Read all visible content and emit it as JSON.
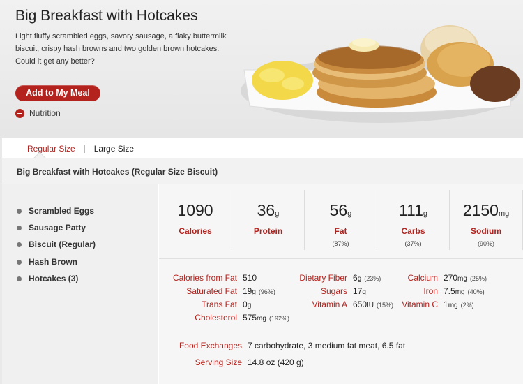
{
  "product": {
    "title": "Big Breakfast with Hotcakes",
    "description": "Light fluffy scrambled eggs, savory sausage, a flaky buttermilk biscuit, crispy hash browns and two golden brown hotcakes. Could it get any better?",
    "add_button": "Add to My Meal",
    "nutrition_toggle": "Nutrition"
  },
  "size_tabs": [
    "Regular Size",
    "Large Size"
  ],
  "item_title": "Big Breakfast with Hotcakes (Regular Size Biscuit)",
  "ingredients": [
    "Scrambled Eggs",
    "Sausage Patty",
    "Biscuit (Regular)",
    "Hash Brown",
    "Hotcakes (3)"
  ],
  "stats": [
    {
      "value": "1090",
      "unit": "",
      "label": "Calories",
      "pct": ""
    },
    {
      "value": "36",
      "unit": "g",
      "label": "Protein",
      "pct": ""
    },
    {
      "value": "56",
      "unit": "g",
      "label": "Fat",
      "pct": "(87%)"
    },
    {
      "value": "111",
      "unit": "g",
      "label": "Carbs",
      "pct": "(37%)"
    },
    {
      "value": "2150",
      "unit": "mg",
      "label": "Sodium",
      "pct": "(90%)"
    }
  ],
  "details": {
    "calories_from_fat": {
      "label": "Calories from Fat",
      "value": "510",
      "unit": "",
      "pct": ""
    },
    "saturated_fat": {
      "label": "Saturated Fat",
      "value": "19",
      "unit": "g",
      "pct": "(96%)"
    },
    "trans_fat": {
      "label": "Trans Fat",
      "value": "0",
      "unit": "g",
      "pct": ""
    },
    "cholesterol": {
      "label": "Cholesterol",
      "value": "575",
      "unit": "mg",
      "pct": "(192%)"
    },
    "dietary_fiber": {
      "label": "Dietary Fiber",
      "value": "6",
      "unit": "g",
      "pct": "(23%)"
    },
    "sugars": {
      "label": "Sugars",
      "value": "17",
      "unit": "g",
      "pct": ""
    },
    "vitamin_a": {
      "label": "Vitamin A",
      "value": "650",
      "unit": "IU",
      "pct": "(15%)"
    },
    "calcium": {
      "label": "Calcium",
      "value": "270",
      "unit": "mg",
      "pct": "(25%)"
    },
    "iron": {
      "label": "Iron",
      "value": "7.5",
      "unit": "mg",
      "pct": "(40%)"
    },
    "vitamin_c": {
      "label": "Vitamin C",
      "value": "1",
      "unit": "mg",
      "pct": "(2%)"
    }
  },
  "food_exchanges": {
    "label": "Food Exchanges",
    "value": "7 carbohydrate, 3 medium fat meat, 6.5 fat"
  },
  "serving_size": {
    "label": "Serving Size",
    "value": "14.8 oz (420 g)"
  },
  "colors": {
    "accent": "#b3221d",
    "panel": "#f6f6f6"
  },
  "icons": {
    "nutrition_toggle": "minus-circle-icon",
    "ingredient_bullet": "bullet-icon"
  }
}
